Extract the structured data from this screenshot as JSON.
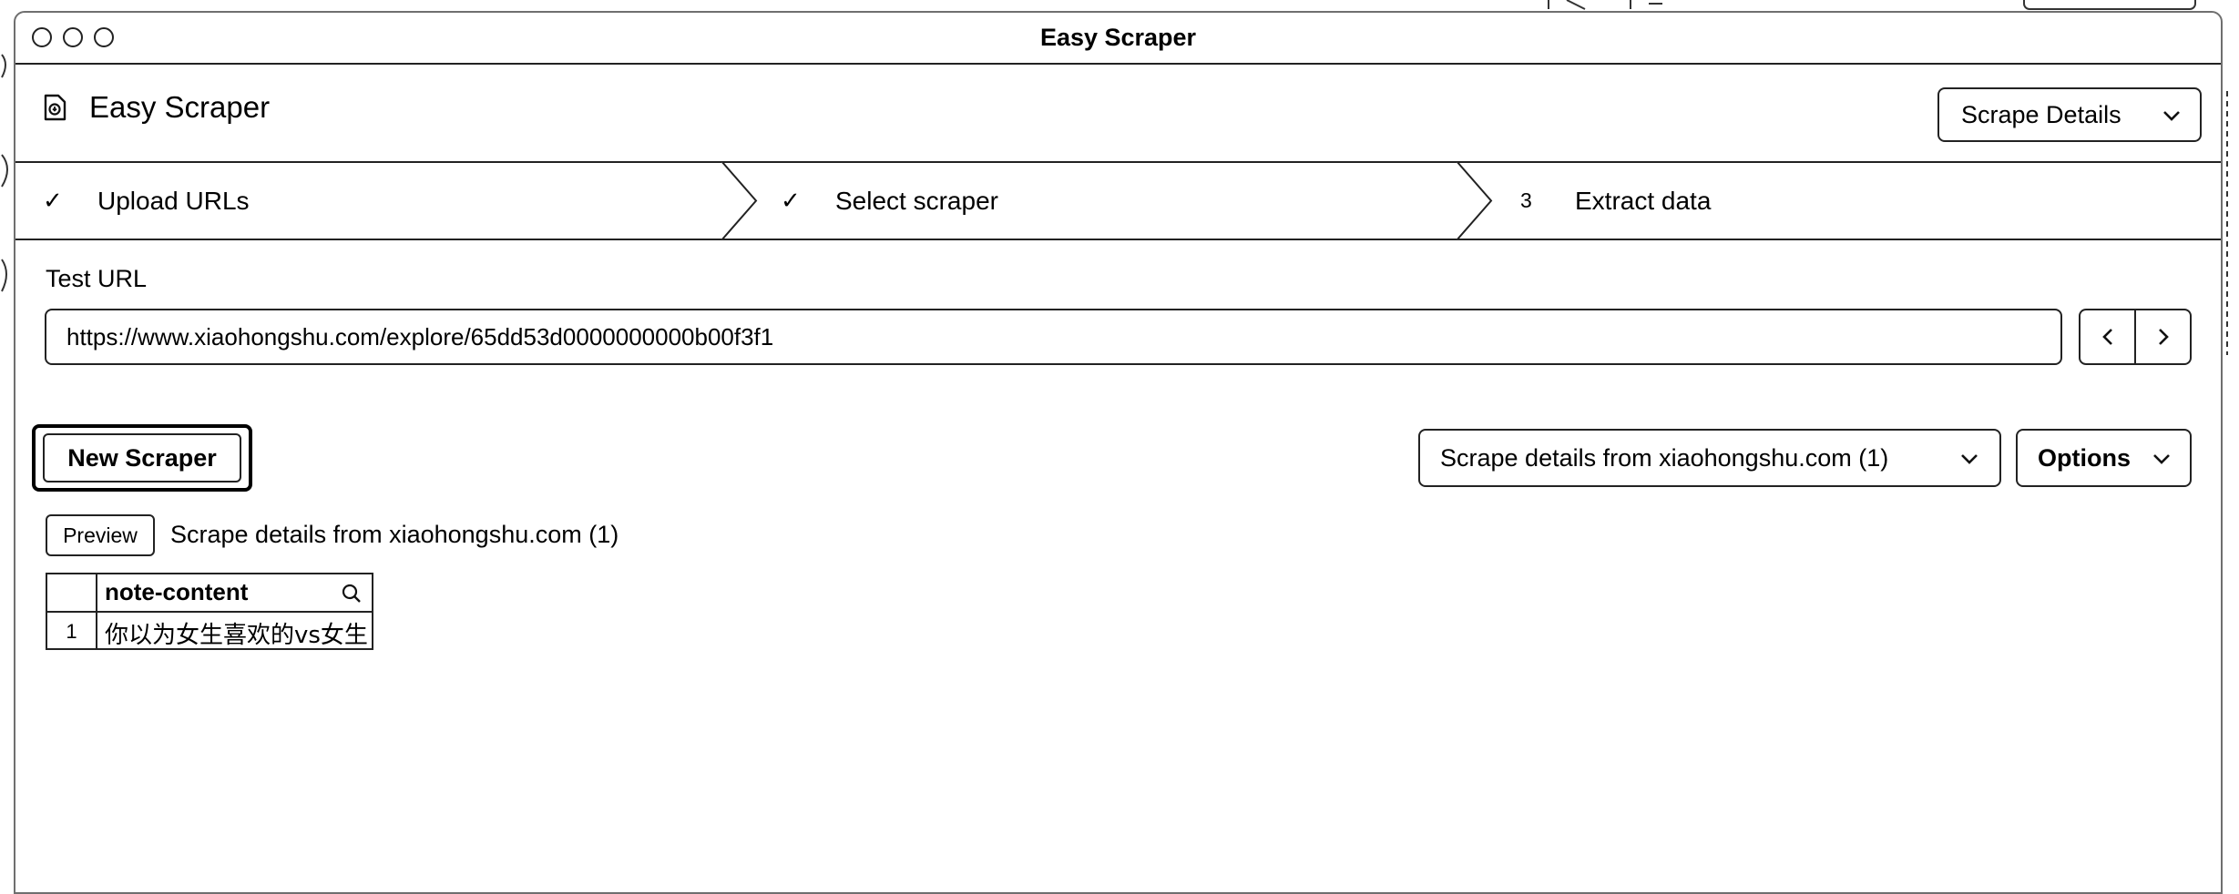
{
  "window": {
    "title": "Easy Scraper"
  },
  "app": {
    "name": "Easy Scraper",
    "icon": "scraper-document-icon"
  },
  "header": {
    "mode_select": "Scrape Details"
  },
  "steps": [
    {
      "mark": "✓",
      "label": "Upload URLs",
      "state": "done"
    },
    {
      "mark": "✓",
      "label": "Select scraper",
      "state": "done"
    },
    {
      "mark": "3",
      "label": "Extract data",
      "state": "current"
    }
  ],
  "test_url": {
    "label": "Test URL",
    "value": "https://www.xiaohongshu.com/explore/65dd53d0000000000b00f3f1"
  },
  "toolbar": {
    "new_scraper": "New Scraper",
    "scraper_select": "Scrape details from xiaohongshu.com (1)",
    "options": "Options"
  },
  "preview": {
    "button": "Preview",
    "title": "Scrape details from xiaohongshu.com (1)",
    "columns": [
      "note-content"
    ],
    "rows": [
      {
        "index": "1",
        "note_content": "你以为女生喜欢的vs女生"
      }
    ]
  },
  "colors": {
    "line": "#222222",
    "background": "#ffffff",
    "text": "#000000"
  }
}
